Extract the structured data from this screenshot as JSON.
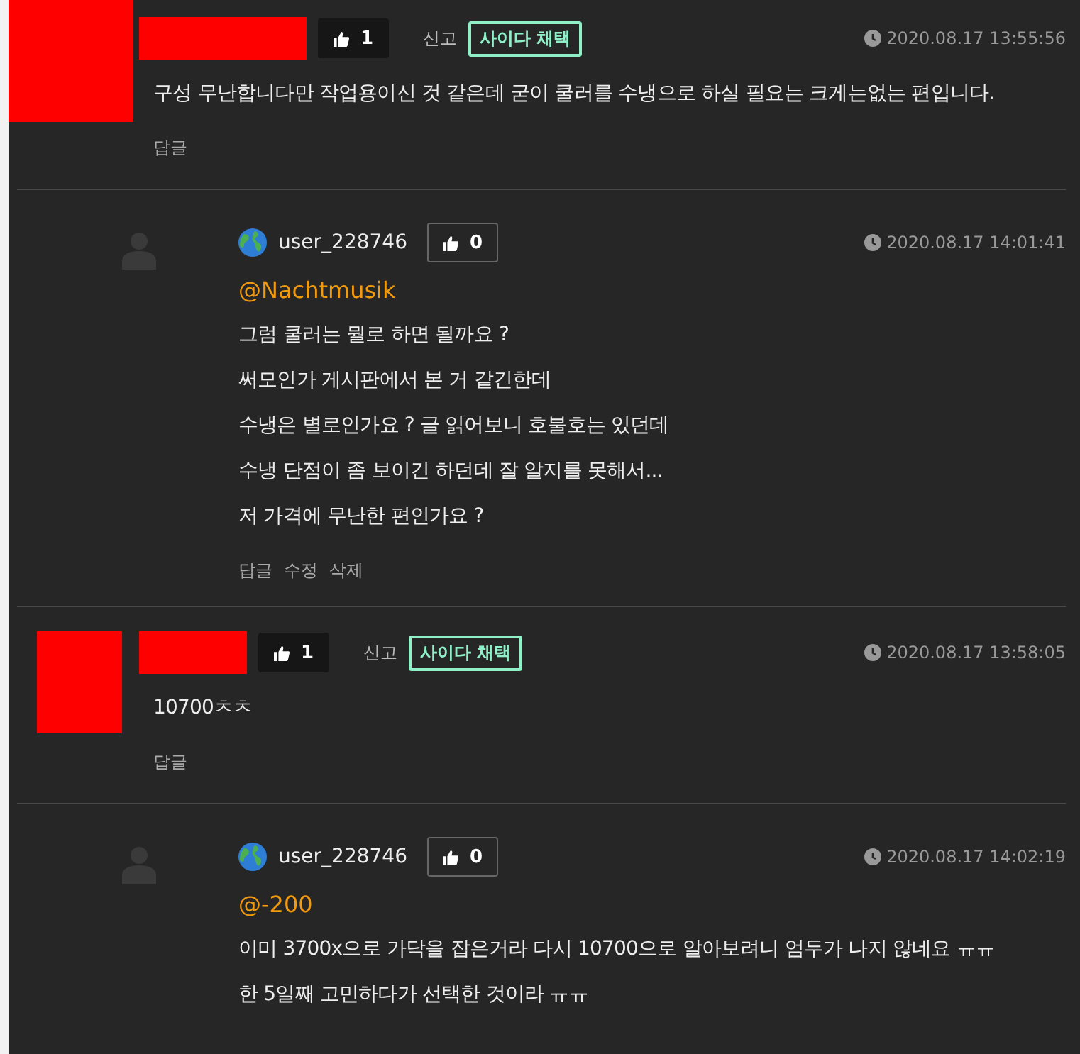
{
  "comments": [
    {
      "kind": "comment",
      "likes": "1",
      "report": "신고",
      "badge": "사이다 채택",
      "time": "2020.08.17 13:55:56",
      "lines": [
        "구성 무난합니다만 작업용이신 것 같은데 굳이 쿨러를 수냉으로 하실 필요는 크게는없는 편입니다."
      ],
      "actions": [
        "답글"
      ]
    },
    {
      "kind": "reply",
      "user": "user_228746",
      "likes": "0",
      "time": "2020.08.17 14:01:41",
      "mention": "@Nachtmusik",
      "lines": [
        "그럼 쿨러는 뭘로 하면 될까요 ?",
        "써모인가 게시판에서 본 거 같긴한데",
        "수냉은 별로인가요 ? 글 읽어보니 호불호는 있던데",
        "수냉 단점이 좀 보이긴 하던데 잘 알지를 못해서...",
        "저 가격에 무난한 편인가요 ?"
      ],
      "actions": [
        "답글",
        "수정",
        "삭제"
      ]
    },
    {
      "kind": "comment",
      "likes": "1",
      "report": "신고",
      "badge": "사이다 채택",
      "time": "2020.08.17 13:58:05",
      "lines": [
        "10700ㅊㅊ"
      ],
      "actions": [
        "답글"
      ]
    },
    {
      "kind": "reply",
      "user": "user_228746",
      "likes": "0",
      "time": "2020.08.17 14:02:19",
      "mention": "@-200",
      "lines": [
        "이미 3700x으로 가닥을 잡은거라 다시 10700으로 알아보려니 엄두가 나지 않네요 ㅠㅠ",
        "한 5일째 고민하다가 선택한 것이라 ㅠㅠ"
      ]
    }
  ]
}
